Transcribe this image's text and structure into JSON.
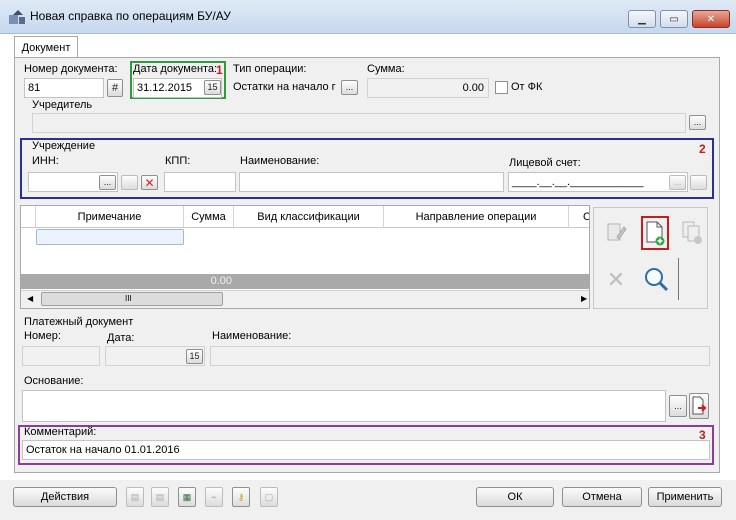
{
  "window": {
    "title": "Новая справка по операциям БУ/АУ",
    "minimize_icon": "minimize-icon",
    "maximize_icon": "maximize-icon",
    "close_icon": "close-icon"
  },
  "tabs": [
    {
      "label": "Документ"
    }
  ],
  "doc": {
    "number_label": "Номер документа:",
    "number_value": "81",
    "date_label": "Дата документа:",
    "date_value": "31.12.2015",
    "optype_label": "Тип операции:",
    "optype_value": "Остатки на начало г",
    "sum_label": "Сумма:",
    "sum_value": "0.00",
    "fk_label": "От ФК",
    "fk_checked": false
  },
  "founder": {
    "label": "Учредитель",
    "value": ""
  },
  "institution": {
    "group_label": "Учреждение",
    "inn_label": "ИНН:",
    "kpp_label": "КПП:",
    "name_label": "Наименование:",
    "account_label": "Лицевой счет:",
    "account_mask": "____.__.__.____________"
  },
  "grid": {
    "columns": [
      "Примечание",
      "Сумма",
      "Вид классификации",
      "Направление операции",
      "О"
    ],
    "total_sum": "0.00",
    "scroll_grip": "III"
  },
  "payment": {
    "group_label": "Платежный документ",
    "number_label": "Номер:",
    "date_label": "Дата:",
    "name_label": "Наименование:"
  },
  "basis": {
    "label": "Основание:",
    "value": ""
  },
  "comment": {
    "label": "Комментарий:",
    "value": "Остаток на начало 01.01.2016"
  },
  "annotations": [
    "1",
    "2",
    "3"
  ],
  "buttons": {
    "actions": "Действия",
    "ok": "ОК",
    "cancel": "Отмена",
    "apply": "Применить",
    "ellipsis": "...",
    "calendar": "15",
    "hash": "#"
  },
  "colors": {
    "box1": "#2e9b3c",
    "box2": "#2b2f8f",
    "box3": "#8a3d9a",
    "annotation": "#c41e1e",
    "grid_total_row": "#a9a9a9",
    "selected_cell": "#eaf3ff"
  }
}
